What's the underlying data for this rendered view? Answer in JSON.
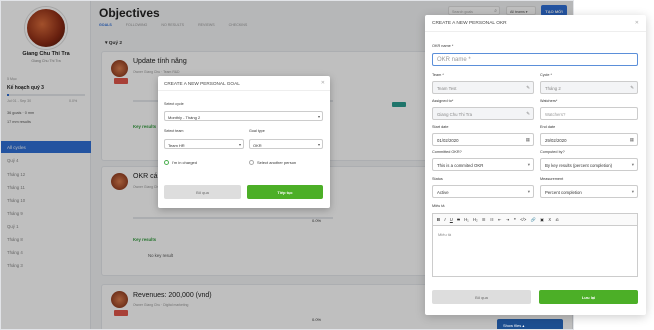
{
  "sidebar": {
    "user_name": "Giang Chu Thi Tra",
    "user_role": "Giang Chu Thi Tra",
    "period_label": "5 Mục",
    "plan_title": "Kế hoạch quý 3",
    "date_from": "Jul 01 - Sep 30",
    "progress_pct": "0.0%",
    "goals_stat": "36 goals · 0 mm",
    "results_stat": "17 mm results",
    "all_cycles": "All cycles",
    "cycles": [
      "Quý 4",
      "Tháng 12",
      "Tháng 11",
      "Tháng 10",
      "Tháng 9",
      "Quý 1",
      "Tháng 8",
      "Tháng 4",
      "Tháng 3"
    ]
  },
  "header": {
    "title": "Objectives",
    "tabs": [
      "GOALS",
      "FOLLOWING",
      "NO RESULTS",
      "REVIEWS",
      "CHECKINS"
    ],
    "search_placeholder": "Search goals",
    "filter_label": "All teams",
    "new_button": "TẠO MỚI"
  },
  "section_title": "Quý 2",
  "objectives": [
    {
      "title": "Update tính năng",
      "meta": "Owner Giang Chu · Team R&D",
      "kr_label": "Key results",
      "pct": "0.0%"
    },
    {
      "title": "OKR cá nhân",
      "meta": "Owner Giang Chu · Team HR",
      "kr_label": "Key results",
      "no_kr": "No key result",
      "pct": "0.0%"
    },
    {
      "title": "Revenues: 200,000 (vnd)",
      "meta": "Owner Giang Chu · Digital marketing",
      "pct": "0.0%"
    }
  ],
  "center_modal": {
    "title": "CREATE A NEW PERSONAL GOAL",
    "cycle_label": "Select cycle",
    "cycle_value": "Monthly - Tháng 2",
    "team_label": "Select team",
    "team_value": "Team HR",
    "goaltype_label": "Goal type",
    "goaltype_value": "OKR",
    "radio_charged": "I'm in charged",
    "radio_other": "Select another person",
    "skip_button": "Bỏ qua",
    "continue_button": "Tiếp tục"
  },
  "right_modal": {
    "title": "CREATE A NEW PERSONAL OKR",
    "okr_name_label": "OKR name *",
    "okr_name_placeholder": "OKR name *",
    "team_label": "Team *",
    "team_value": "Team Test",
    "cycle_label": "Cycle *",
    "cycle_value": "Tháng 2",
    "assigned_label": "Assigned to*",
    "assigned_value": "Giang Chu Thi Tra",
    "watchers_label": "Watchers*",
    "watchers_placeholder": "Watchers?",
    "start_label": "Start date",
    "start_value": "01/02/2020",
    "end_label": "End date",
    "end_value": "29/02/2020",
    "committed_label": "Committed OKR?",
    "committed_value": "This is a commited OKR",
    "computed_label": "Computed by?",
    "computed_value": "By key results (percent completion)",
    "status_label": "Status",
    "status_value": "Active",
    "measurement_label": "Measurement",
    "measurement_value": "Percent completion",
    "desc_label": "Miêu tả",
    "toolbar": [
      "B",
      "I",
      "U",
      "S",
      "H₁",
      "H₂",
      "☰",
      "☷",
      "⇤",
      "⇥",
      "❝",
      "</>",
      "🔗",
      "▣",
      "Ⅹ",
      "⎌"
    ],
    "desc_placeholder": "Miêu tả",
    "skip_button": "Bỏ qua",
    "save_button": "Lưu lại"
  },
  "footer_hint": "Show files"
}
